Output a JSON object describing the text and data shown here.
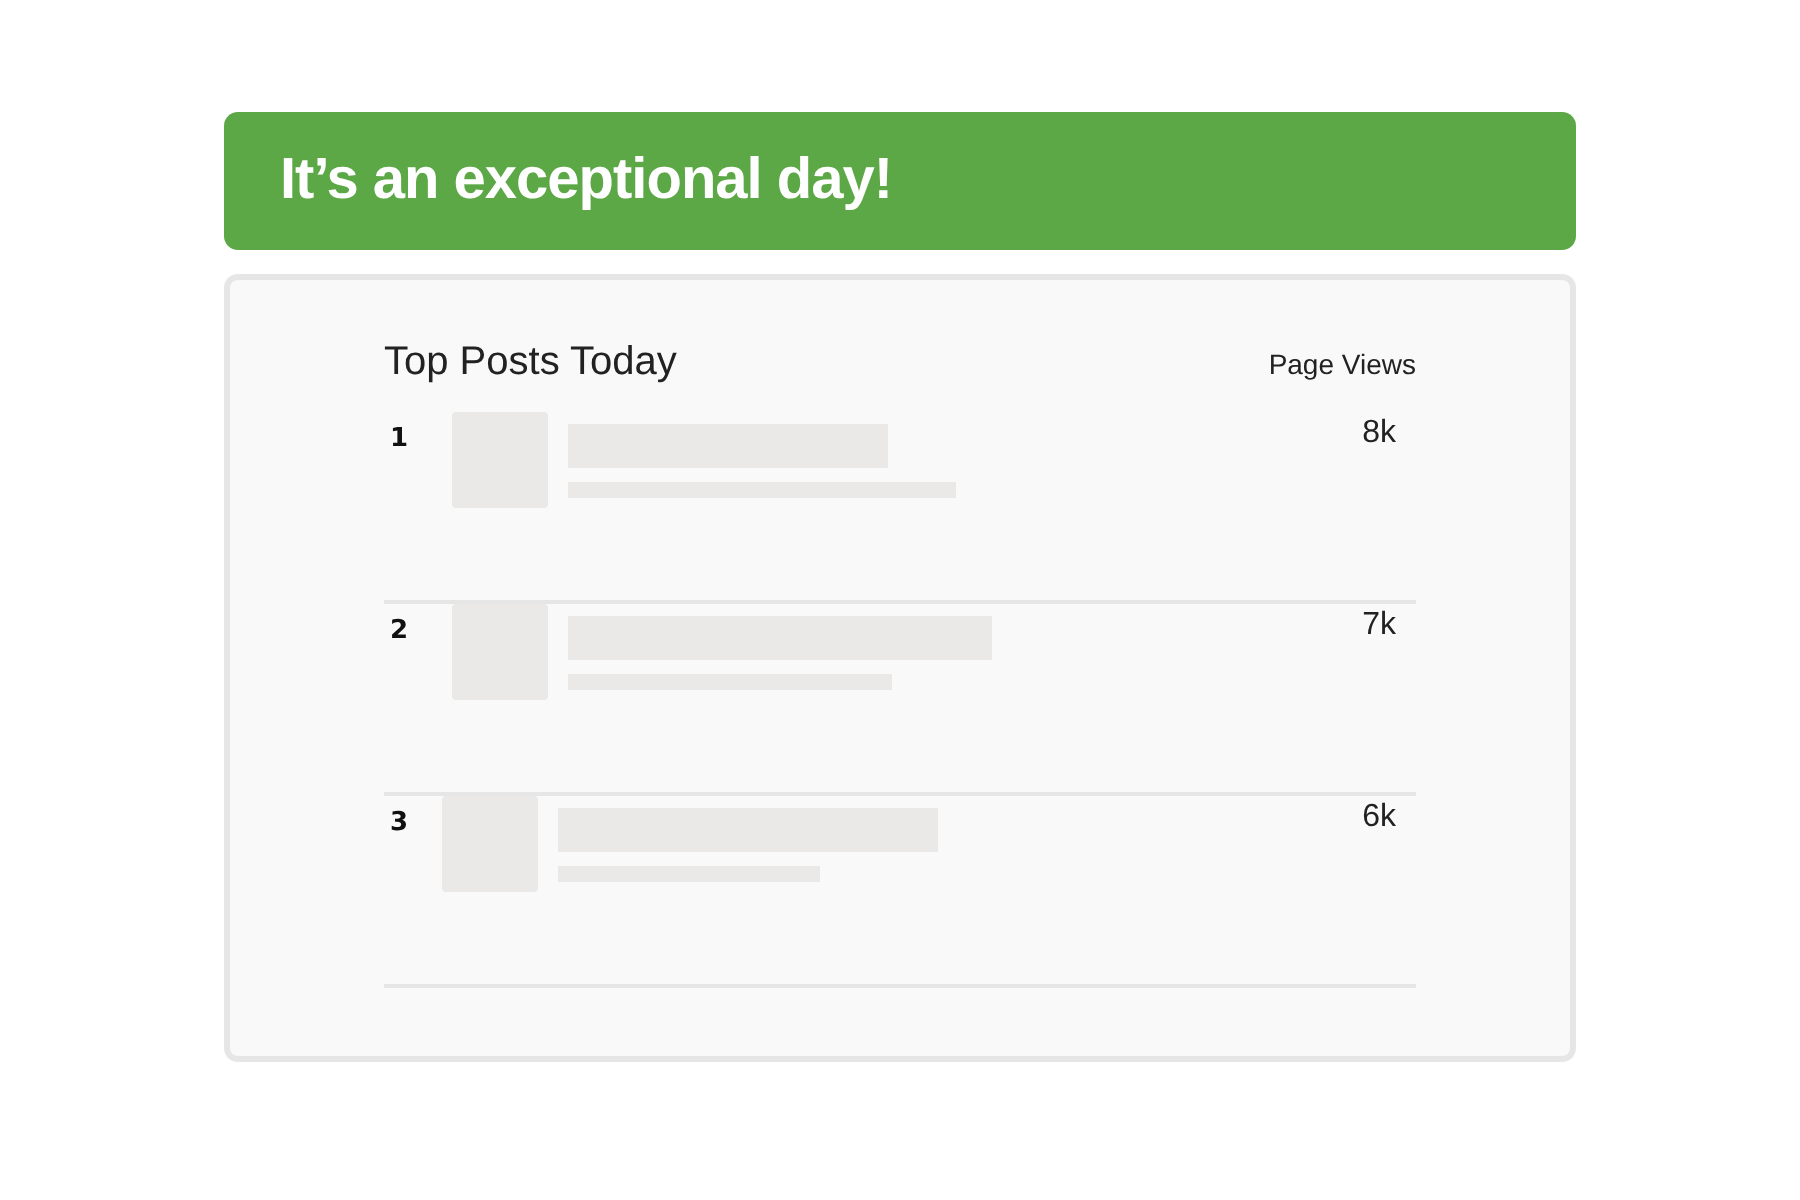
{
  "banner": {
    "title": "It’s an exceptional day!"
  },
  "card": {
    "title": "Top Posts Today",
    "column_header": "Page Views",
    "rows": [
      {
        "rank": "1",
        "views": "8k"
      },
      {
        "rank": "2",
        "views": "7k"
      },
      {
        "rank": "3",
        "views": "6k"
      }
    ]
  }
}
